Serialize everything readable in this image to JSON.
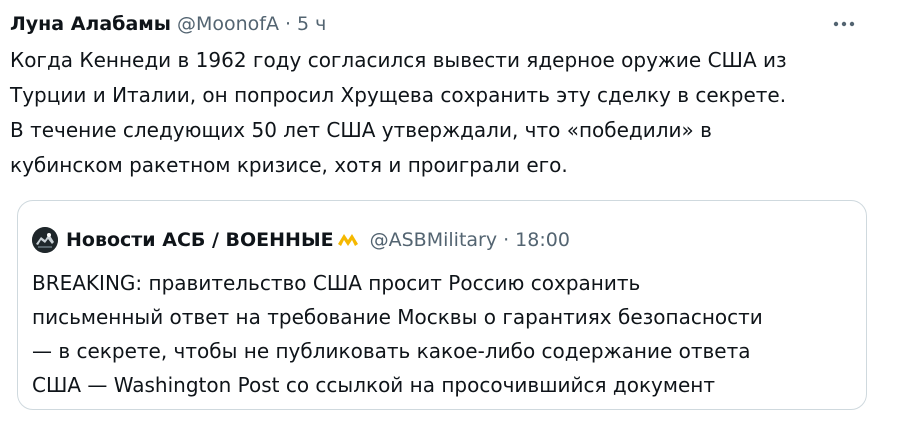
{
  "tweet": {
    "author_name": "Луна Алабамы",
    "author_handle": "@MoonofA",
    "separator": "·",
    "timestamp": "5 ч",
    "more_icon": "more-horizontal-icon",
    "text_lines": [
      "Когда Кеннеди в 1962 году согласился вывести ядерное оружие США из",
      "Турции и Италии, он попросил Хрущева сохранить эту сделку в секрете.",
      "В течение следующих 50 лет США утверждали, что «победили» в",
      "кубинском ракетном кризисе, хотя и проиграли его."
    ]
  },
  "quoted_tweet": {
    "author_name": "Новости АСБ / ВОЕННЫЕ",
    "badge_icon": "yellow-chevron-emoji-icon",
    "author_handle": "@ASBMilitary",
    "separator": "·",
    "timestamp": "18:00",
    "text_lines": [
      "BREAKING: правительство США просит Россию сохранить",
      "письменный ответ на требование Москвы о гарантиях безопасности",
      "— в секрете, чтобы не публиковать какое-либо содержание ответа",
      "США — Washington Post со ссылкой на просочившийся документ"
    ]
  },
  "colors": {
    "text_primary": "#0f1419",
    "text_secondary": "#536471",
    "border": "#cfd9de",
    "badge_yellow": "#f5b800"
  }
}
